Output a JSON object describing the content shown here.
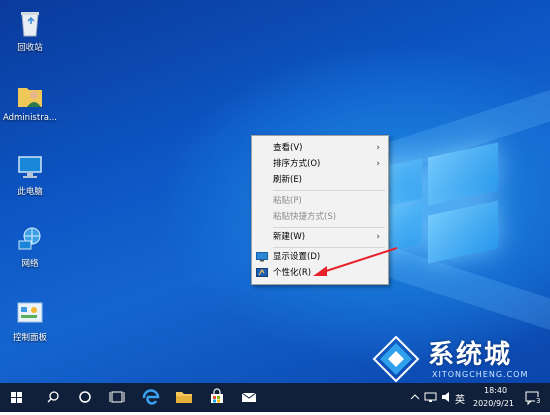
{
  "desktop_icons": [
    {
      "label": "回收站",
      "icon": "recycle-bin-icon"
    },
    {
      "label": "Administra...",
      "icon": "user-folder-icon"
    },
    {
      "label": "此电脑",
      "icon": "this-pc-icon"
    },
    {
      "label": "网络",
      "icon": "network-icon"
    },
    {
      "label": "控制面板",
      "icon": "control-panel-icon"
    }
  ],
  "context_menu": {
    "items": [
      {
        "label": "查看(V)",
        "has_submenu": true,
        "enabled": true
      },
      {
        "label": "排序方式(O)",
        "has_submenu": true,
        "enabled": true
      },
      {
        "label": "刷新(E)",
        "has_submenu": false,
        "enabled": true
      },
      {
        "label": "粘贴(P)",
        "has_submenu": false,
        "enabled": false
      },
      {
        "label": "粘贴快捷方式(S)",
        "has_submenu": false,
        "enabled": false
      },
      {
        "label": "新建(W)",
        "has_submenu": true,
        "enabled": true
      },
      {
        "label": "显示设置(D)",
        "has_submenu": false,
        "enabled": true,
        "icon": "display-settings-icon"
      },
      {
        "label": "个性化(R)",
        "has_submenu": false,
        "enabled": true,
        "icon": "personalize-icon"
      }
    ]
  },
  "taskbar": {
    "items": [
      "start-icon",
      "search-icon",
      "cortana-icon",
      "task-view-icon",
      "edge-icon",
      "file-explorer-icon",
      "store-icon",
      "mail-icon"
    ],
    "tray": {
      "input_method": "英",
      "time": "18:40",
      "date": "2020/9/21",
      "notification_count": "3"
    }
  },
  "watermark": {
    "text": "系统城",
    "subtext": "XITONGCHENG.COM"
  },
  "colors": {
    "annotation_arrow": "#e8222a",
    "taskbar_bg": "#10203a",
    "wallpaper_primary": "#0d58c6"
  }
}
